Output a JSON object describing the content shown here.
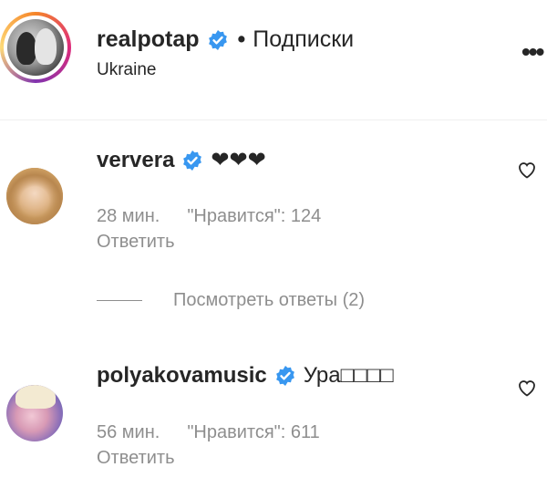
{
  "post_header": {
    "username": "realpotap",
    "separator": "•",
    "follow_state": "Подписки",
    "location": "Ukraine",
    "more_label": "•••"
  },
  "comments": [
    {
      "username": "ververa",
      "text": "❤❤❤",
      "time": "28 мин.",
      "likes": "\"Нравится\": 124",
      "reply_label": "Ответить"
    },
    {
      "username": "polyakovamusic",
      "text": "Ура□□□□",
      "time": "56 мин.",
      "likes": "\"Нравится\": 611",
      "reply_label": "Ответить"
    }
  ],
  "view_replies_label": "Посмотреть ответы (2)",
  "icons": {
    "verified": "verified-badge-icon",
    "heart": "heart-outline-icon",
    "more": "more-options-icon"
  },
  "colors": {
    "verified_blue": "#3897f0",
    "text_primary": "#262626",
    "text_secondary": "#8e8e8e"
  }
}
